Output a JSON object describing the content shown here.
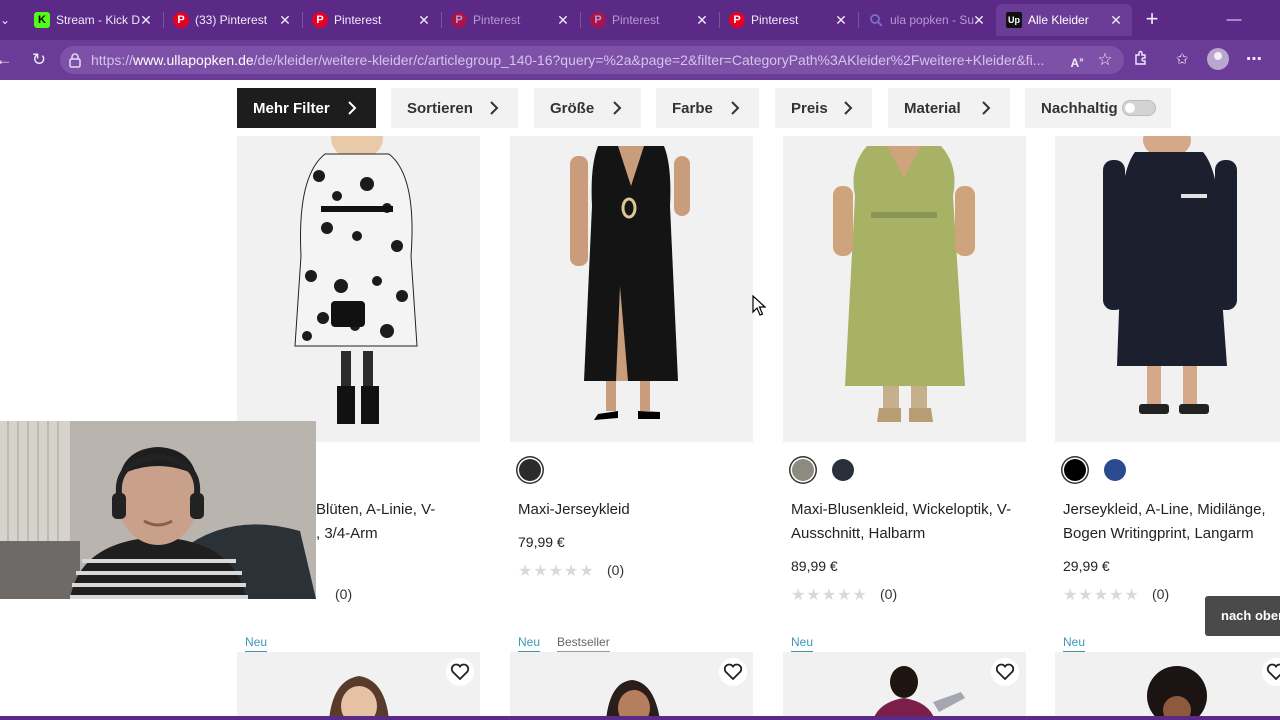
{
  "browser": {
    "tabs": [
      {
        "title": "Stream - Kick D",
        "favicon": "K"
      },
      {
        "title": "(33) Pinterest",
        "favicon": "P"
      },
      {
        "title": "Pinterest",
        "favicon": "P"
      },
      {
        "title": "Pinterest",
        "favicon": "P"
      },
      {
        "title": "Pinterest",
        "favicon": "P"
      },
      {
        "title": "Pinterest",
        "favicon": "P"
      },
      {
        "title": "ula popken - Su",
        "favicon": "search-icon"
      },
      {
        "title": "Alle Kleider",
        "favicon": "Up"
      }
    ],
    "url_prefix": "https://",
    "url_host": "www.ullapopken.de",
    "url_path": "/de/kleider/weitere-kleider/c/articlegroup_140-16?query=%2a&page=2&filter=CategoryPath%3AKleider%2Fweitere+Kleider&fi..."
  },
  "filters": {
    "more": "Mehr Filter",
    "sort": "Sortieren",
    "size": "Größe",
    "color": "Farbe",
    "price": "Preis",
    "material": "Material",
    "sustainable": "Nachhaltig",
    "sustainable_on": false
  },
  "products": [
    {
      "name_line1": "Blüten, A-Linie, V-",
      "name_line2": ", 3/4-Arm",
      "rating_count": "(0)",
      "swatches": []
    },
    {
      "name_line1": "Maxi-Jerseykleid",
      "name_line2": "",
      "price": "79,99 €",
      "rating_count": "(0)",
      "swatches": [
        "#2b2b2b"
      ]
    },
    {
      "name_line1": "Maxi-Blusenkleid, Wickeloptik, V-",
      "name_line2": "Ausschnitt, Halbarm",
      "price": "89,99 €",
      "rating_count": "(0)",
      "swatches": [
        "#8d8b80",
        "#2a2f3c"
      ]
    },
    {
      "name_line1": "Jerseykleid, A-Line, Midilänge,",
      "name_line2": "Bogen Writingprint, Langarm",
      "price": "29,99 €",
      "rating_count": "(0)",
      "swatches": [
        "#000000",
        "#2c4a8f"
      ]
    }
  ],
  "next_row": {
    "badges": [
      "Neu",
      "Neu",
      "Bestseller",
      "Neu",
      "Neu"
    ]
  },
  "back_to_top": "nach oben",
  "colors": {
    "browser_frame": "#5a2a86",
    "toolbar": "#6b3c97",
    "badge_new": "#3c97b5"
  }
}
